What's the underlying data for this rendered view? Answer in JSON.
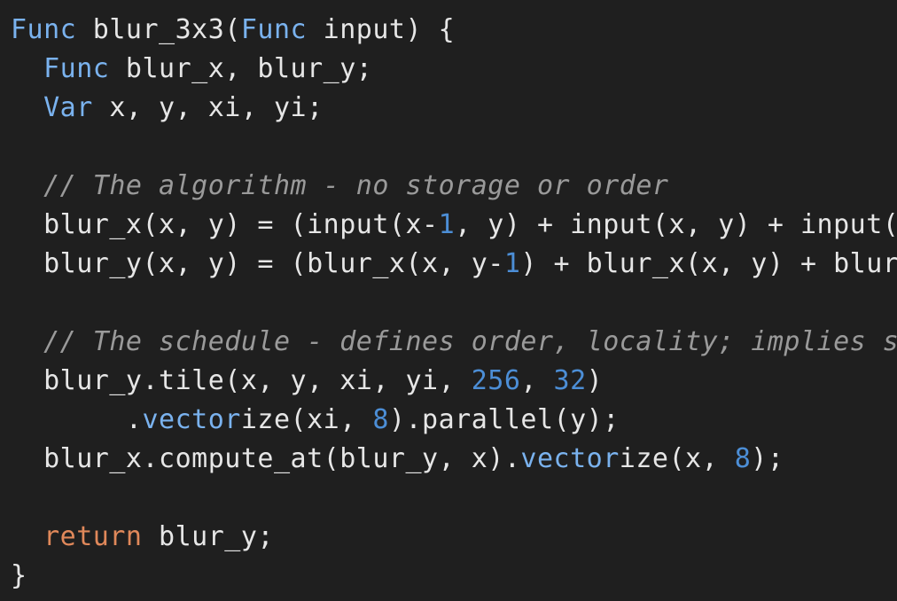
{
  "colors": {
    "background": "#1f1f1f",
    "plain": "#e6e6e6",
    "keyword": "#7ab2ee",
    "return_keyword": "#e0885a",
    "number": "#4c8ed6",
    "comment": "#9a9a9a"
  },
  "code": {
    "lines": [
      {
        "tokens": [
          {
            "t": "kw",
            "v": "Func"
          },
          {
            "t": "plain",
            "v": " blur_3x3("
          },
          {
            "t": "kw",
            "v": "Func"
          },
          {
            "t": "plain",
            "v": " input) {"
          }
        ]
      },
      {
        "tokens": [
          {
            "t": "plain",
            "v": "  "
          },
          {
            "t": "kw",
            "v": "Func"
          },
          {
            "t": "plain",
            "v": " blur_x, blur_y;"
          }
        ]
      },
      {
        "tokens": [
          {
            "t": "plain",
            "v": "  "
          },
          {
            "t": "kw",
            "v": "Var"
          },
          {
            "t": "plain",
            "v": " x, y, xi, yi;"
          }
        ]
      },
      {
        "tokens": []
      },
      {
        "tokens": [
          {
            "t": "plain",
            "v": "  "
          },
          {
            "t": "comment",
            "v": "// The algorithm - no storage or order"
          }
        ]
      },
      {
        "tokens": [
          {
            "t": "plain",
            "v": "  blur_x(x, y) = (input(x-"
          },
          {
            "t": "num",
            "v": "1"
          },
          {
            "t": "plain",
            "v": ", y) + input(x, y) + input(x+"
          }
        ]
      },
      {
        "tokens": [
          {
            "t": "plain",
            "v": "  blur_y(x, y) = (blur_x(x, y-"
          },
          {
            "t": "num",
            "v": "1"
          },
          {
            "t": "plain",
            "v": ") + blur_x(x, y) + blur_x"
          }
        ]
      },
      {
        "tokens": []
      },
      {
        "tokens": [
          {
            "t": "plain",
            "v": "  "
          },
          {
            "t": "comment",
            "v": "// The schedule - defines order, locality; implies sto"
          }
        ]
      },
      {
        "tokens": [
          {
            "t": "plain",
            "v": "  blur_y.tile(x, y, xi, yi, "
          },
          {
            "t": "num",
            "v": "256"
          },
          {
            "t": "plain",
            "v": ", "
          },
          {
            "t": "num",
            "v": "32"
          },
          {
            "t": "plain",
            "v": ")"
          }
        ]
      },
      {
        "tokens": [
          {
            "t": "plain",
            "v": "       ."
          },
          {
            "t": "kw",
            "v": "vector"
          },
          {
            "t": "plain",
            "v": "ize(xi, "
          },
          {
            "t": "num",
            "v": "8"
          },
          {
            "t": "plain",
            "v": ").parallel(y);"
          }
        ]
      },
      {
        "tokens": [
          {
            "t": "plain",
            "v": "  blur_x.compute_at(blur_y, x)."
          },
          {
            "t": "kw",
            "v": "vector"
          },
          {
            "t": "plain",
            "v": "ize(x, "
          },
          {
            "t": "num",
            "v": "8"
          },
          {
            "t": "plain",
            "v": ");"
          }
        ]
      },
      {
        "tokens": []
      },
      {
        "tokens": [
          {
            "t": "plain",
            "v": "  "
          },
          {
            "t": "ret",
            "v": "return"
          },
          {
            "t": "plain",
            "v": " blur_y;"
          }
        ]
      },
      {
        "tokens": [
          {
            "t": "plain",
            "v": "}"
          }
        ]
      }
    ]
  }
}
